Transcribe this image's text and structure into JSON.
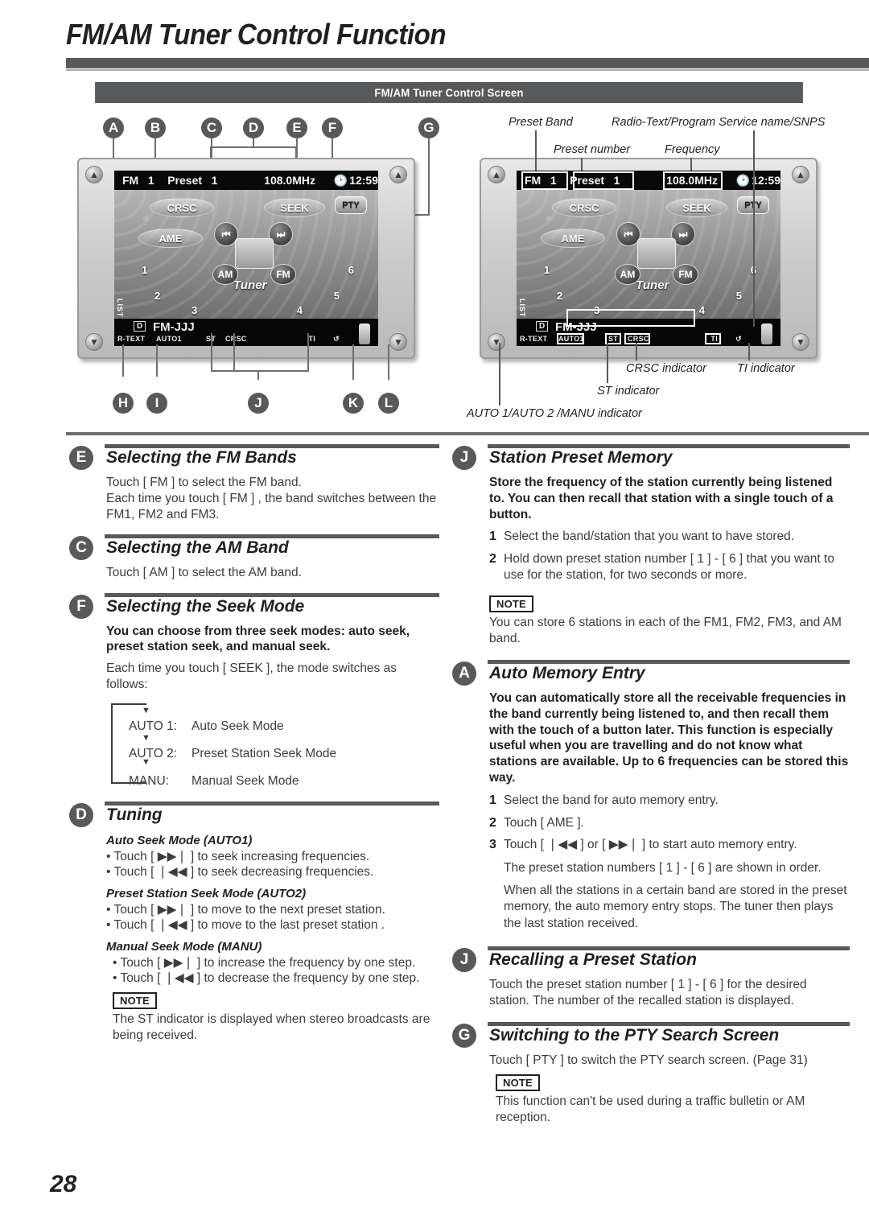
{
  "page": {
    "title": "FM/AM Tuner Control Function",
    "number": "28"
  },
  "figure": {
    "caption": "FM/AM Tuner Control Screen",
    "callouts_top": [
      "A",
      "B",
      "C",
      "D",
      "E",
      "F",
      "G"
    ],
    "callouts_bottom": [
      "H",
      "I",
      "J",
      "K",
      "L"
    ],
    "screen": {
      "band": "FM",
      "band_number": "1",
      "preset_label": "Preset",
      "preset_number": "1",
      "frequency": "108.0MHz",
      "clock": "12:59",
      "clock_icon": "clock-icon",
      "crsc_button": "CRSC",
      "seek_button": "SEEK",
      "pty_button": "PTY",
      "ame_button": "AME",
      "am_button": "AM",
      "fm_button": "FM",
      "tuner_label": "Tuner",
      "prev_icon": "skip-back-icon",
      "next_icon": "skip-forward-icon",
      "list_tab": "LIST",
      "preset_numbers": [
        "1",
        "2",
        "3",
        "4",
        "5",
        "6"
      ],
      "disc_badge": "D",
      "station_name": "FM-JJJ",
      "ind_rtext": "R-TEXT",
      "ind_auto": "AUTO1",
      "ind_st": "ST",
      "ind_crsc": "CRSC",
      "ind_ti": "TI",
      "repeat_icon": "repeat-icon",
      "pencil_icon": "pencil-icon"
    },
    "annotations": {
      "preset_band": "Preset Band",
      "preset_number": "Preset number",
      "frequency": "Frequency",
      "radio_text": "Radio-Text/Program Service name/SNPS",
      "auto_indicator": "AUTO 1/AUTO 2 /MANU indicator",
      "st_indicator": "ST indicator",
      "crsc_indicator": "CRSC indicator",
      "ti_indicator": "TI indicator"
    }
  },
  "left_column": [
    {
      "badge": "E",
      "title": "Selecting the FM Bands",
      "paragraphs": [
        "Touch [ FM ] to select the FM band.",
        "Each time you touch [ FM ] , the band switches between the FM1, FM2 and FM3."
      ]
    },
    {
      "badge": "C",
      "title": "Selecting the AM Band",
      "paragraphs": [
        "Touch [ AM ] to select the AM band."
      ]
    },
    {
      "badge": "F",
      "title": "Selecting the Seek Mode",
      "bold_intro": "You can choose from three seek modes: auto seek, preset station seek, and manual seek.",
      "paragraphs": [
        "Each time you touch [ SEEK ], the mode switches as follows:"
      ],
      "flow": [
        {
          "key": "AUTO 1:",
          "value": "Auto Seek Mode"
        },
        {
          "key": "AUTO 2:",
          "value": "Preset Station Seek Mode"
        },
        {
          "key": "MANU:",
          "value": "Manual Seek Mode"
        }
      ]
    },
    {
      "badge": "D",
      "title": "Tuning",
      "subsections": [
        {
          "heading": "Auto Seek Mode (AUTO1)",
          "bullets": [
            "Touch [ ▶▶❘ ] to seek increasing frequencies.",
            "Touch [ ❘◀◀ ] to seek decreasing frequencies."
          ]
        },
        {
          "heading": "Preset Station Seek Mode (AUTO2)",
          "bullets": [
            "Touch [ ▶▶❘ ] to move to the next preset station.",
            "Touch [ ❘◀◀ ] to move to the last preset station ."
          ]
        },
        {
          "heading": "Manual Seek Mode (MANU)",
          "bullets": [
            "Touch [ ▶▶❘ ] to increase the frequency by one step.",
            "Touch [ ❘◀◀ ] to decrease the frequency by one step."
          ]
        }
      ],
      "note_label": "NOTE",
      "note_text": "The ST indicator is displayed when stereo broadcasts are being received."
    }
  ],
  "right_column": [
    {
      "badge": "J",
      "title": "Station Preset Memory",
      "bold_intro": "Store the frequency of the station currently being listened to. You can then recall that station with a single touch of a button.",
      "steps": [
        {
          "n": "1",
          "t": "Select the band/station that you want to have stored."
        },
        {
          "n": "2",
          "t": "Hold down preset station number [ 1 ] - [ 6 ] that you want to use for the station, for two seconds or more."
        }
      ],
      "note_label": "NOTE",
      "note_text": "You can store 6 stations in each of the FM1, FM2, FM3, and AM band."
    },
    {
      "badge": "A",
      "title": "Auto Memory Entry",
      "bold_intro": "You can automatically store all the receivable frequencies in the band currently being listened to, and then recall them with the touch of a button later. This function is especially useful when you are travelling and do not know what stations are available. Up to 6 frequencies can be stored this way.",
      "steps": [
        {
          "n": "1",
          "t": "Select the band for auto memory entry."
        },
        {
          "n": "2",
          "t": "Touch [ AME ]."
        },
        {
          "n": "3",
          "t": "Touch [ ❘◀◀ ] or [ ▶▶❘ ] to start auto memory entry."
        }
      ],
      "trailing_paragraphs": [
        "The preset station numbers [ 1 ] - [ 6 ] are shown in order.",
        "When all the stations in a certain band are stored in the preset memory, the auto memory entry stops. The tuner then plays the last station received."
      ]
    },
    {
      "badge": "J",
      "title": "Recalling a Preset Station",
      "paragraphs": [
        "Touch the preset station number [ 1 ] - [ 6 ] for the desired station. The number of the recalled station is displayed."
      ]
    },
    {
      "badge": "G",
      "title": "Switching to the PTY Search Screen",
      "paragraphs": [
        "Touch [ PTY ] to switch the PTY search screen. (Page 31)"
      ],
      "note_label": "NOTE",
      "note_text": "This function can't be used during a traffic bulletin or AM reception."
    }
  ],
  "colors": {
    "rule": "#58595b",
    "text": "#231f20",
    "body": "#3c3c3c"
  }
}
